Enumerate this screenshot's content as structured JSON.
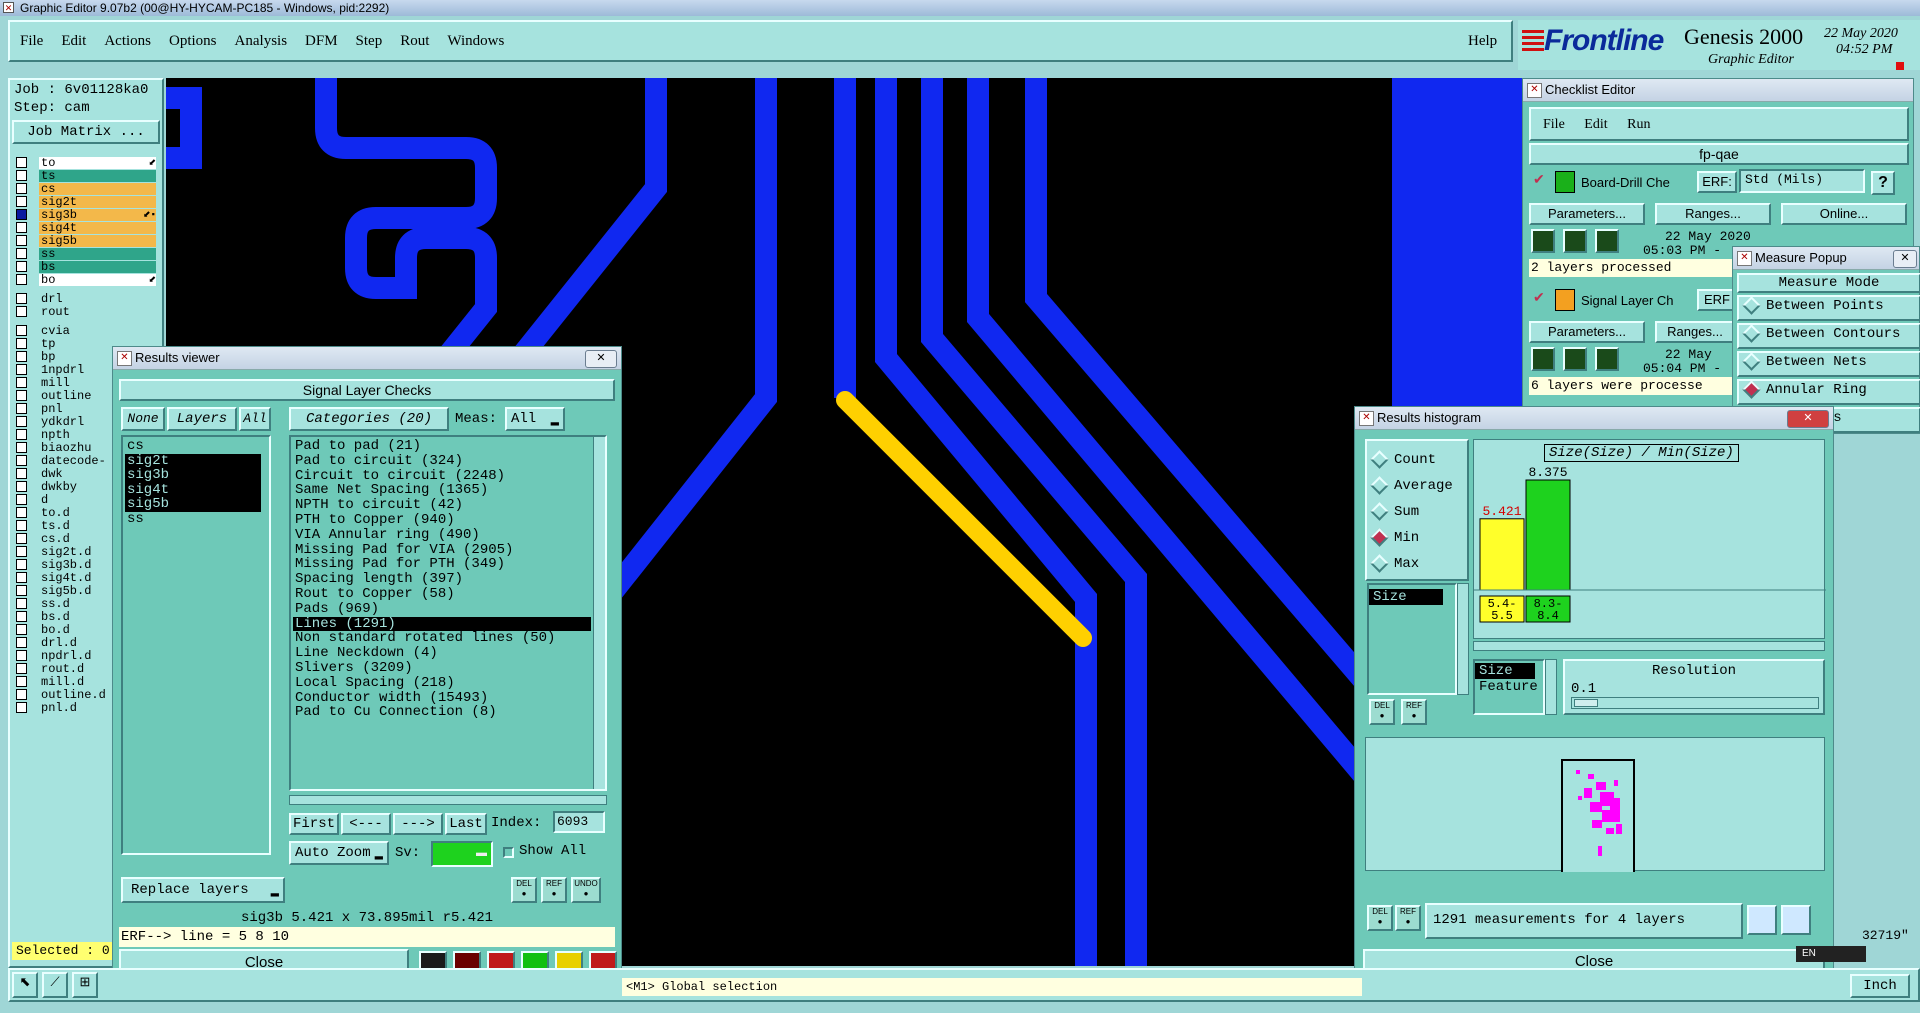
{
  "app": {
    "window_title": "Graphic Editor 9.07b2 (00@HY-HYCAM-PC185 - Windows, pid:2292)",
    "menu": [
      "File",
      "Edit",
      "Actions",
      "Options",
      "Analysis",
      "DFM",
      "Step",
      "Rout",
      "Windows"
    ],
    "help": "Help",
    "brand": "Frontline",
    "product": "Genesis 2000",
    "product_sub": "Graphic Editor",
    "date": "22 May 2020",
    "time": "04:52 PM"
  },
  "left": {
    "job": "Job : 6v01128ka0",
    "step": "Step: cam",
    "job_matrix": "Job Matrix ...",
    "layers_top": [
      {
        "name": "to",
        "color": "#ffffff",
        "mark": "⬋"
      },
      {
        "name": "ts",
        "color": "#2fa58a",
        "mark": ""
      },
      {
        "name": "cs",
        "color": "#f3b84a",
        "mark": ""
      },
      {
        "name": "sig2t",
        "color": "#f3b84a",
        "mark": ""
      },
      {
        "name": "sig3b",
        "color": "#f3b84a",
        "mark": "⬋▪"
      },
      {
        "name": "sig4t",
        "color": "#f3b84a",
        "mark": ""
      },
      {
        "name": "sig5b",
        "color": "#f3b84a",
        "mark": ""
      },
      {
        "name": "ss",
        "color": "#2fa58a",
        "mark": ""
      },
      {
        "name": "bs",
        "color": "#2fa58a",
        "mark": ""
      },
      {
        "name": "bo",
        "color": "#ffffff",
        "mark": "⬋"
      }
    ],
    "layers_mid": [
      "drl",
      "rout"
    ],
    "layers_bottom": [
      "cvia",
      "tp",
      "bp",
      "1npdrl",
      "mill",
      "outline",
      "pnl",
      "ydkdrl",
      "npth",
      "biaozhu",
      "datecode-",
      "dwk",
      "dwkby",
      "d",
      "to.d",
      "ts.d",
      "cs.d",
      "sig2t.d",
      "sig3b.d",
      "sig4t.d",
      "sig5b.d",
      "ss.d",
      "bs.d",
      "bo.d",
      "drl.d",
      "npdrl.d",
      "rout.d",
      "mill.d",
      "outline.d",
      "pnl.d"
    ],
    "selected": "Selected : 0"
  },
  "results_viewer": {
    "title": "Results viewer",
    "header": "Signal Layer Checks",
    "none_btn": "None",
    "layers_btn": "Layers",
    "all_btn": "All",
    "categories_btn": "Categories (20)",
    "meas_label": "Meas:",
    "meas_value": "All",
    "layers": [
      {
        "name": "cs",
        "sel": false
      },
      {
        "name": "sig2t",
        "sel": true
      },
      {
        "name": "sig3b",
        "sel": true
      },
      {
        "name": "sig4t",
        "sel": true
      },
      {
        "name": "sig5b",
        "sel": true
      },
      {
        "name": "ss",
        "sel": false
      }
    ],
    "categories": [
      {
        "name": "Pad to pad (21)",
        "sel": false
      },
      {
        "name": "Pad to circuit (324)",
        "sel": false
      },
      {
        "name": "Circuit to circuit (2248)",
        "sel": false
      },
      {
        "name": "Same Net Spacing (1365)",
        "sel": false
      },
      {
        "name": "NPTH to circuit (42)",
        "sel": false
      },
      {
        "name": "PTH to Copper (940)",
        "sel": false
      },
      {
        "name": "VIA Annular ring (490)",
        "sel": false
      },
      {
        "name": "Missing Pad for VIA (2905)",
        "sel": false
      },
      {
        "name": "Missing Pad for PTH (349)",
        "sel": false
      },
      {
        "name": "Spacing length (397)",
        "sel": false
      },
      {
        "name": "Rout to Copper (58)",
        "sel": false
      },
      {
        "name": "Pads (969)",
        "sel": false
      },
      {
        "name": "Lines (1291)",
        "sel": true
      },
      {
        "name": "Non standard rotated lines (50)",
        "sel": false
      },
      {
        "name": "Line Neckdown (4)",
        "sel": false
      },
      {
        "name": "Slivers (3209)",
        "sel": false
      },
      {
        "name": "Local Spacing (218)",
        "sel": false
      },
      {
        "name": "Conductor width (15493)",
        "sel": false
      },
      {
        "name": "Pad to Cu Connection (8)",
        "sel": false
      }
    ],
    "nav": {
      "first": "First",
      "prev": "<---",
      "next": "--->",
      "last": "Last",
      "index_label": "Index:",
      "index_value": "6093"
    },
    "auto_zoom": "Auto Zoom",
    "sv_label": "Sv:",
    "show_all": "Show All",
    "replace_layers": "Replace layers",
    "status": "sig3b 5.421 x 73.895mil  r5.421",
    "erf": "ERF--> line = 5 8 10",
    "close": "Close"
  },
  "checklist": {
    "title": "Checklist Editor",
    "menu": [
      "File",
      "Edit",
      "Run"
    ],
    "name": "fp-qae",
    "items": [
      {
        "label": "Board-Drill Che",
        "erf": "ERF:",
        "erf_value": "Std (Mils)",
        "params": "Parameters...",
        "ranges": "Ranges...",
        "online": "Online...",
        "date": "22 May 2020",
        "time": "05:03 PM -",
        "status": "2 layers processed"
      },
      {
        "label": "Signal Layer Ch",
        "erf": "ERF",
        "params": "Parameters...",
        "ranges": "Ranges...",
        "date": "22 May",
        "time": "05:04 PM -",
        "status": "6 layers were processe"
      }
    ]
  },
  "measure": {
    "title": "Measure Popup",
    "header": "Measure Mode",
    "modes": [
      {
        "label": "Between Points",
        "on": false
      },
      {
        "label": "Between Contours",
        "on": false
      },
      {
        "label": "Between Nets",
        "on": false
      },
      {
        "label": "Annular Ring",
        "on": true
      },
      {
        "label": "Midpoints",
        "on": false
      }
    ]
  },
  "histogram": {
    "title": "Results histogram",
    "modes": [
      {
        "label": "Count",
        "on": false
      },
      {
        "label": "Average",
        "on": false
      },
      {
        "label": "Sum",
        "on": false
      },
      {
        "label": "Min",
        "on": true
      },
      {
        "label": "Max",
        "on": false
      }
    ],
    "chart_title": "Size(Size) / Min(Size)",
    "field_item": "Size",
    "bars": [
      {
        "value": 5.421,
        "label": "5.421",
        "range": "5.4- 5.5",
        "color": "#ffff2a",
        "label_color": "#d40000"
      },
      {
        "value": 8.375,
        "label": "8.375",
        "range": "8.3- 8.4",
        "color": "#1ed21e",
        "label_color": "#000000"
      }
    ],
    "size_item": "Size",
    "feature_item": "Feature",
    "resolution_label": "Resolution",
    "resolution_value": "0.1",
    "summary": "1291 measurements for 4 layers",
    "close": "Close"
  },
  "bottom": {
    "hint": "<M1> Global selection",
    "unit": "Inch",
    "coord": "32719\"",
    "lang": "EN"
  }
}
